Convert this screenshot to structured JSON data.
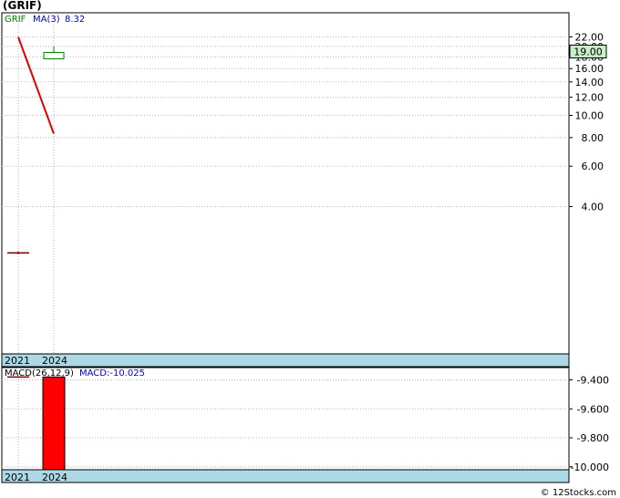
{
  "title": "(GRIF)",
  "credit": "© 12Stocks.com",
  "colors": {
    "grid": "#b5b5b5",
    "price_line": "#e00000",
    "candle": "#008000",
    "macd_bar": "#ff0000",
    "axis_band": "#add8e6",
    "last_price_bg": "#c8f0c8",
    "ma_label": "#0000cc",
    "symbol_label": "#008000"
  },
  "chart_data": [
    {
      "type": "line",
      "panel": "price",
      "symbol": "GRIF",
      "ma_label": "MA(3)",
      "ma_value": "8.32",
      "last_price": "19.00",
      "y_scale": "log",
      "ylim": [
        2.5,
        23.5
      ],
      "y_ticks": [
        "22.00",
        "20.00",
        "18.00",
        "16.00",
        "14.00",
        "12.00",
        "10.00",
        "8.00",
        "6.00",
        "4.00"
      ],
      "x_ticks": [
        "2021",
        "2024"
      ],
      "grid": true,
      "series": [
        {
          "x": [
            "2021",
            "2024"
          ],
          "values": [
            22.0,
            8.32
          ]
        }
      ],
      "candles": [
        {
          "x": "2021",
          "open": 2.51,
          "close": 2.51,
          "high": 2.55,
          "low": 2.47
        },
        {
          "x": "2024",
          "open": 18.6,
          "close": 19.0,
          "high": 20.0,
          "low": 18.5
        }
      ]
    },
    {
      "type": "bar",
      "panel": "macd",
      "label": "MACD(26,12,9)",
      "macd_label": "MACD:-10.025",
      "ylim": [
        -10.04,
        -9.36
      ],
      "y_ticks": [
        "-9.400",
        "-9.600",
        "-9.800",
        "-10.000"
      ],
      "x_ticks": [
        "2021",
        "2024"
      ],
      "grid": true,
      "categories": [
        "2024"
      ],
      "values": [
        -10.025
      ],
      "reference": -9.38
    }
  ]
}
